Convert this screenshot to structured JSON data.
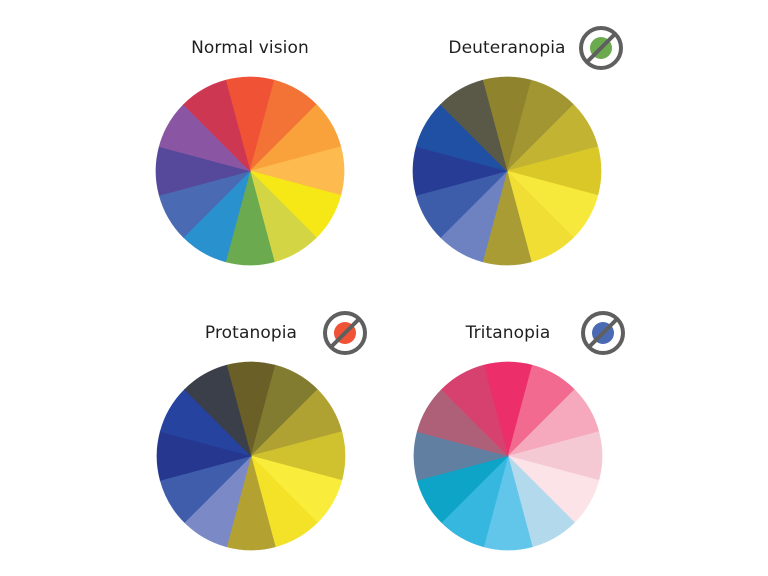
{
  "figure": {
    "panels": [
      {
        "id": "normal",
        "title": "Normal vision",
        "icon": null,
        "segments": [
          "#F05236",
          "#F37236",
          "#F9A13A",
          "#FDBA4E",
          "#F5E816",
          "#D4D544",
          "#6BAA4E",
          "#2A91CF",
          "#4A6BB3",
          "#56489A",
          "#8A56A3",
          "#CE3752"
        ]
      },
      {
        "id": "deuteranopia",
        "title": "Deuteranopia",
        "icon": {
          "name": "no-green-icon",
          "dot_color": "#6BAA4E"
        },
        "segments": [
          "#8F832E",
          "#A19632",
          "#C2B333",
          "#D9C828",
          "#F7E83C",
          "#F0DE34",
          "#A99C35",
          "#6E82C2",
          "#3D5DAA",
          "#263C95",
          "#2050A3",
          "#5A5948"
        ]
      },
      {
        "id": "protanopia",
        "title": "Protanopia",
        "icon": {
          "name": "no-red-icon",
          "dot_color": "#F05236"
        },
        "segments": [
          "#6A5F26",
          "#827C30",
          "#B0A232",
          "#D0C22E",
          "#F9EC3A",
          "#F4E229",
          "#B3A232",
          "#7B8AC6",
          "#3F5DAA",
          "#25378F",
          "#25439F",
          "#3B3F4A"
        ]
      },
      {
        "id": "tritanopia",
        "title": "Tritanopia",
        "icon": {
          "name": "no-blue-icon",
          "dot_color": "#4A6BB3"
        },
        "segments": [
          "#EC2F6A",
          "#F26A8F",
          "#F6A8BC",
          "#F5C9D4",
          "#FBE3E8",
          "#B2DAEC",
          "#62C6EA",
          "#36B7DF",
          "#0DA4C7",
          "#617FA0",
          "#AE6078",
          "#D7416F"
        ]
      }
    ],
    "icon_ring_color": "#5F5F5F",
    "title_color": "#1F1F1F"
  }
}
